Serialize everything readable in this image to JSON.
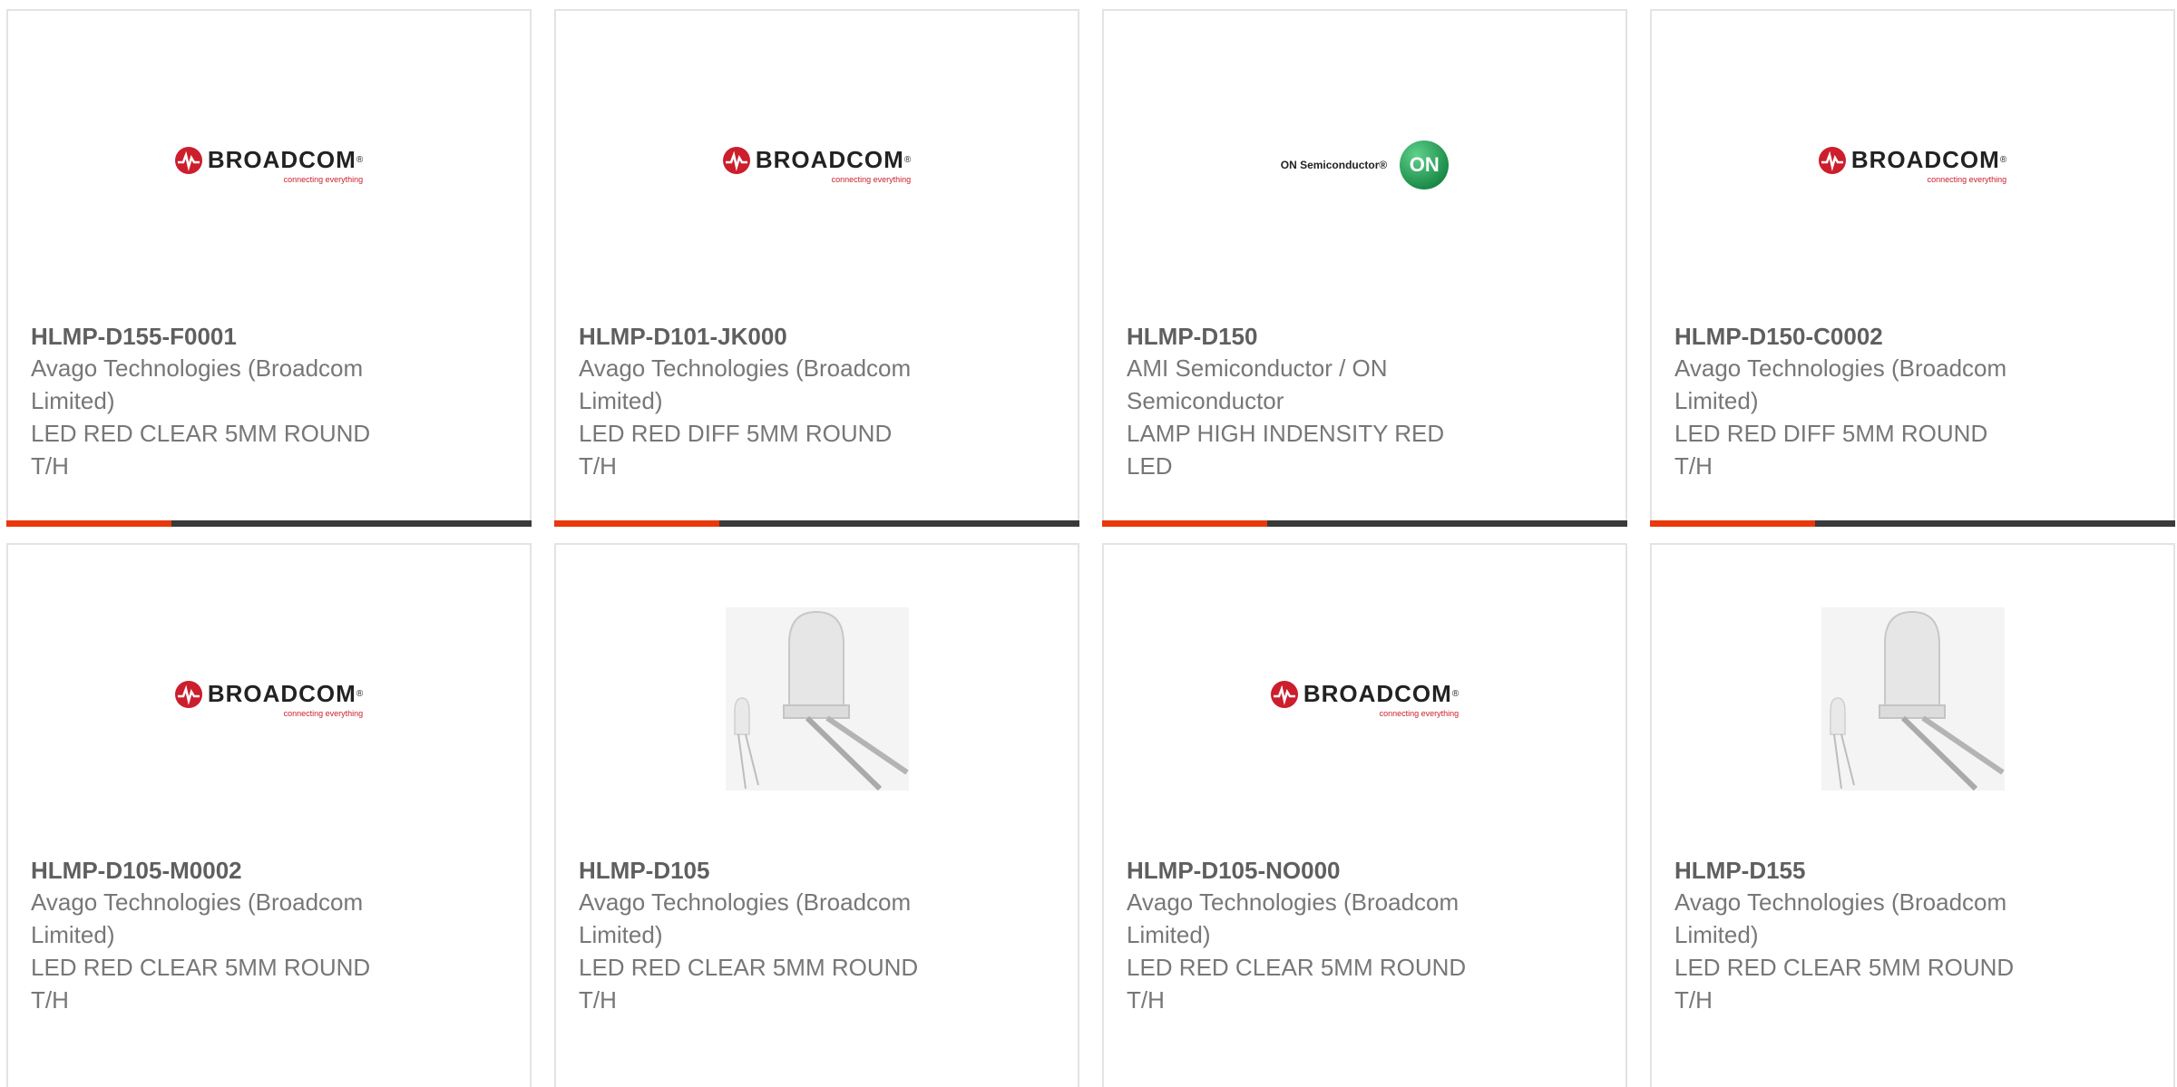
{
  "brand_colors": {
    "accent": "#e8380d",
    "bar": "#3a3a3a",
    "broadcom_red": "#cc1e2c",
    "on_green": "#1c8d4a"
  },
  "logos": {
    "broadcom": {
      "word": "BROADCOM",
      "tm": "®",
      "tagline": "connecting everything"
    },
    "onsemi": {
      "text": "ON Semiconductor®",
      "circle": "ON"
    }
  },
  "products": [
    {
      "part_number": "HLMP-D155-F0001",
      "manufacturer_line1": "Avago Technologies (Broadcom",
      "manufacturer_line2": "Limited)",
      "description_line1": "LED RED CLEAR 5MM ROUND",
      "description_line2": "T/H",
      "image": "broadcom-logo"
    },
    {
      "part_number": "HLMP-D101-JK000",
      "manufacturer_line1": "Avago Technologies (Broadcom",
      "manufacturer_line2": "Limited)",
      "description_line1": "LED RED DIFF 5MM ROUND",
      "description_line2": "T/H",
      "image": "broadcom-logo"
    },
    {
      "part_number": "HLMP-D150",
      "manufacturer_line1": "AMI Semiconductor / ON",
      "manufacturer_line2": "Semiconductor",
      "description_line1": "LAMP HIGH INDENSITY RED",
      "description_line2": "LED",
      "image": "onsemi-logo"
    },
    {
      "part_number": "HLMP-D150-C0002",
      "manufacturer_line1": "Avago Technologies (Broadcom",
      "manufacturer_line2": "Limited)",
      "description_line1": "LED RED DIFF 5MM ROUND",
      "description_line2": "T/H",
      "image": "broadcom-logo"
    },
    {
      "part_number": "HLMP-D105-M0002",
      "manufacturer_line1": "Avago Technologies (Broadcom",
      "manufacturer_line2": "Limited)",
      "description_line1": "LED RED CLEAR 5MM ROUND",
      "description_line2": "T/H",
      "image": "broadcom-logo"
    },
    {
      "part_number": "HLMP-D105",
      "manufacturer_line1": "Avago Technologies (Broadcom",
      "manufacturer_line2": "Limited)",
      "description_line1": "LED RED CLEAR 5MM ROUND",
      "description_line2": "T/H",
      "image": "led-photo"
    },
    {
      "part_number": "HLMP-D105-NO000",
      "manufacturer_line1": "Avago Technologies (Broadcom",
      "manufacturer_line2": "Limited)",
      "description_line1": "LED RED CLEAR 5MM ROUND",
      "description_line2": "T/H",
      "image": "broadcom-logo"
    },
    {
      "part_number": "HLMP-D155",
      "manufacturer_line1": "Avago Technologies (Broadcom",
      "manufacturer_line2": "Limited)",
      "description_line1": "LED RED CLEAR 5MM ROUND",
      "description_line2": "T/H",
      "image": "led-photo"
    }
  ]
}
